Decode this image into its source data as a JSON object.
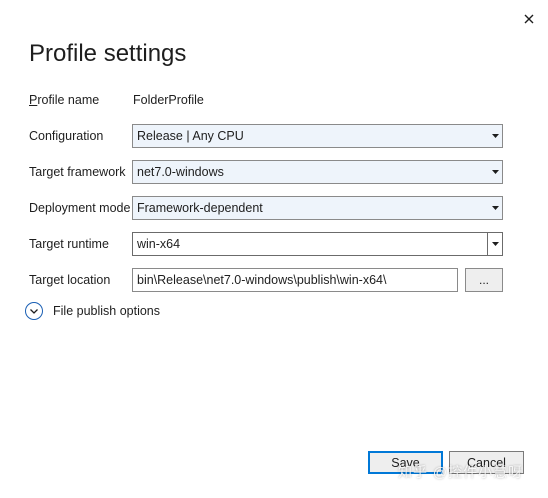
{
  "dialog": {
    "title": "Profile settings",
    "close_icon": "close-icon"
  },
  "fields": {
    "profile_name": {
      "label_prefix": "P",
      "label_rest": "rofile name",
      "value": "FolderProfile"
    },
    "configuration": {
      "label": "Configuration",
      "value": "Release | Any CPU"
    },
    "target_framework": {
      "label": "Target framework",
      "value": "net7.0-windows"
    },
    "deployment_mode": {
      "label": "Deployment mode",
      "value": "Framework-dependent"
    },
    "target_runtime": {
      "label": "Target runtime",
      "value": "win-x64"
    },
    "target_location": {
      "label": "Target location",
      "value": "bin\\Release\\net7.0-windows\\publish\\win-x64\\",
      "browse_label": "..."
    }
  },
  "expander": {
    "label": "File publish options",
    "icon": "chevron-down-icon"
  },
  "buttons": {
    "save": "Save",
    "cancel": "Cancel"
  },
  "watermark": "知乎 @控件小慧呀",
  "colors": {
    "accent": "#0078d7",
    "combo_background": "#eef4fb",
    "expander_border": "#1a5fb4"
  }
}
